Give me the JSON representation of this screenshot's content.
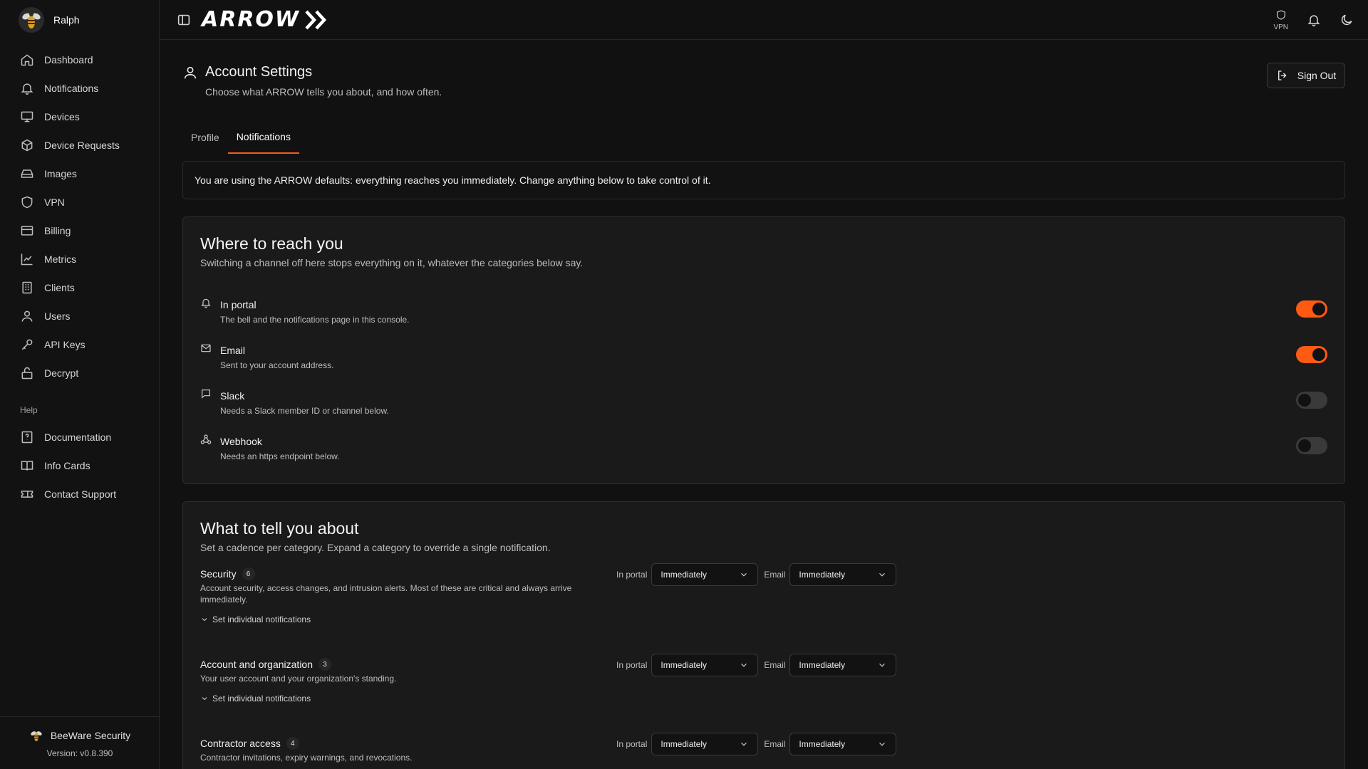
{
  "sidebar": {
    "user_name": "Ralph",
    "items": [
      {
        "label": "Dashboard",
        "icon": "home-icon"
      },
      {
        "label": "Notifications",
        "icon": "bell-icon"
      },
      {
        "label": "Devices",
        "icon": "monitor-icon"
      },
      {
        "label": "Device Requests",
        "icon": "package-icon"
      },
      {
        "label": "Images",
        "icon": "hard-drive-icon"
      },
      {
        "label": "VPN",
        "icon": "shield-icon"
      },
      {
        "label": "Billing",
        "icon": "credit-card-icon"
      },
      {
        "label": "Metrics",
        "icon": "line-chart-icon"
      },
      {
        "label": "Clients",
        "icon": "building-icon"
      },
      {
        "label": "Users",
        "icon": "user-icon"
      },
      {
        "label": "API Keys",
        "icon": "key-icon"
      },
      {
        "label": "Decrypt",
        "icon": "lock-open-icon"
      }
    ],
    "help_label": "Help",
    "help_items": [
      {
        "label": "Documentation",
        "icon": "file-question-icon"
      },
      {
        "label": "Info Cards",
        "icon": "book-open-icon"
      },
      {
        "label": "Contact Support",
        "icon": "ticket-icon"
      }
    ],
    "footer_brand": "BeeWare Security",
    "version": "Version: v0.8.390"
  },
  "topbar": {
    "logo_text": "ARROW",
    "vpn_label": "VPN"
  },
  "page": {
    "title": "Account Settings",
    "subtitle": "Choose what ARROW tells you about, and how often.",
    "signout_label": "Sign Out",
    "tabs": [
      {
        "label": "Profile",
        "active": false
      },
      {
        "label": "Notifications",
        "active": true
      }
    ],
    "banner": "You are using the ARROW defaults: everything reaches you immediately. Change anything below to take control of it."
  },
  "reach": {
    "title": "Where to reach you",
    "description": "Switching a channel off here stops everything on it, whatever the categories below say.",
    "channels": [
      {
        "name": "In portal",
        "description": "The bell and the notifications page in this console.",
        "enabled": true
      },
      {
        "name": "Email",
        "description": "Sent to your account address.",
        "enabled": true
      },
      {
        "name": "Slack",
        "description": "Needs a Slack member ID or channel below.",
        "enabled": false
      },
      {
        "name": "Webhook",
        "description": "Needs an https endpoint below.",
        "enabled": false
      }
    ]
  },
  "tell": {
    "title": "What to tell you about",
    "description": "Set a cadence per category. Expand a category to override a single notification.",
    "portal_label": "In portal",
    "email_label": "Email",
    "expand_label": "Set individual notifications",
    "categories": [
      {
        "name": "Security",
        "count": "6",
        "description": "Account security, access changes, and intrusion alerts. Most of these are critical and always arrive immediately.",
        "portal": "Immediately",
        "email": "Immediately"
      },
      {
        "name": "Account and organization",
        "count": "3",
        "description": "Your user account and your organization's standing.",
        "portal": "Immediately",
        "email": "Immediately"
      },
      {
        "name": "Contractor access",
        "count": "4",
        "description": "Contractor invitations, expiry warnings, and revocations.",
        "portal": "Immediately",
        "email": "Immediately"
      }
    ]
  },
  "colors": {
    "accent": "#ff5a14",
    "background": "#111111",
    "card": "#1a1a1a"
  }
}
